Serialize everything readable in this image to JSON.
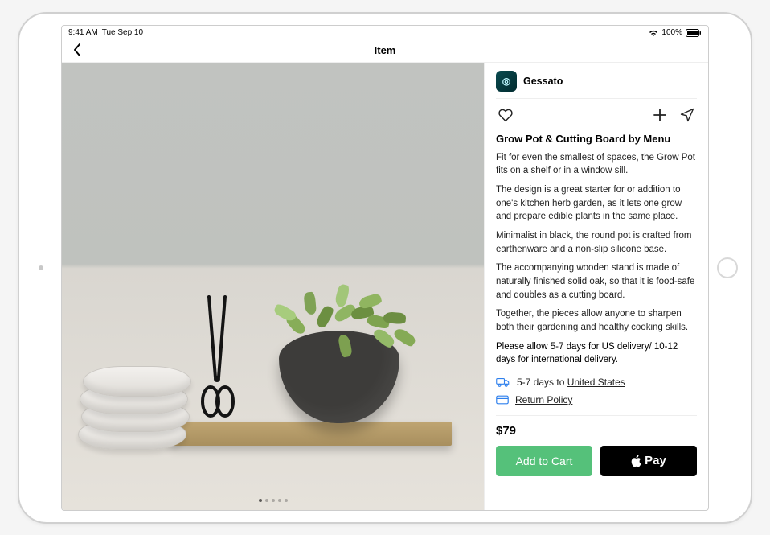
{
  "status": {
    "time": "9:41 AM",
    "date": "Tue Sep 10",
    "battery": "100%"
  },
  "nav": {
    "title": "Item"
  },
  "seller": {
    "name": "Gessato"
  },
  "item": {
    "title": "Grow Pot & Cutting Board by Menu",
    "paragraphs": [
      "Fit for even the smallest of spaces, the Grow Pot fits on a shelf or in a window sill.",
      "The design is a great starter for or addition to one's kitchen herb garden, as it lets one grow and prepare edible plants in the same place.",
      "Minimalist in black, the round pot is crafted from earthenware and a non-slip silicone base.",
      "The accompanying wooden stand is made of naturally finished solid oak, so that it is food-safe and doubles as a cutting board.",
      "Together, the pieces allow anyone to sharpen both their gardening and healthy cooking skills."
    ],
    "delivery_note": "Please allow 5-7 days for US delivery/ 10-12 days for international delivery.",
    "price": "$79"
  },
  "shipping": {
    "prefix": "5-7 days to ",
    "destination": "United States"
  },
  "return_policy_label": "Return Policy",
  "buttons": {
    "add_to_cart": "Add to Cart",
    "apple_pay": "Pay"
  },
  "gallery": {
    "page_count": 5,
    "active_index": 0
  }
}
